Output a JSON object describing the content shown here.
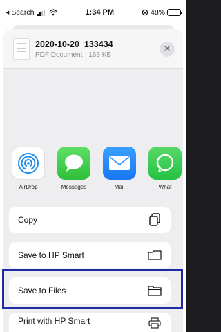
{
  "status_bar": {
    "back_label": "◂ Search",
    "time": "1:34 PM",
    "battery_percent": "48%",
    "battery_level": 0.48
  },
  "document": {
    "title": "2020-10-20_133434",
    "subtitle": "PDF Document · 163 KB"
  },
  "apps": [
    {
      "label": "AirDrop",
      "icon": "airdrop-icon"
    },
    {
      "label": "Messages",
      "icon": "messages-icon"
    },
    {
      "label": "Mail",
      "icon": "mail-icon"
    },
    {
      "label": "What",
      "icon": "whatsapp-icon"
    }
  ],
  "actions": [
    {
      "label": "Copy",
      "icon": "copy-icon"
    },
    {
      "label": "Save to HP Smart",
      "icon": "folder-icon"
    },
    {
      "label": "Save to Files",
      "icon": "folder-icon"
    },
    {
      "label": "Print with HP Smart",
      "icon": "printer-icon"
    }
  ],
  "colors": {
    "highlight_border": "#1f2aa6",
    "sheet_background": "#eeeef0"
  }
}
